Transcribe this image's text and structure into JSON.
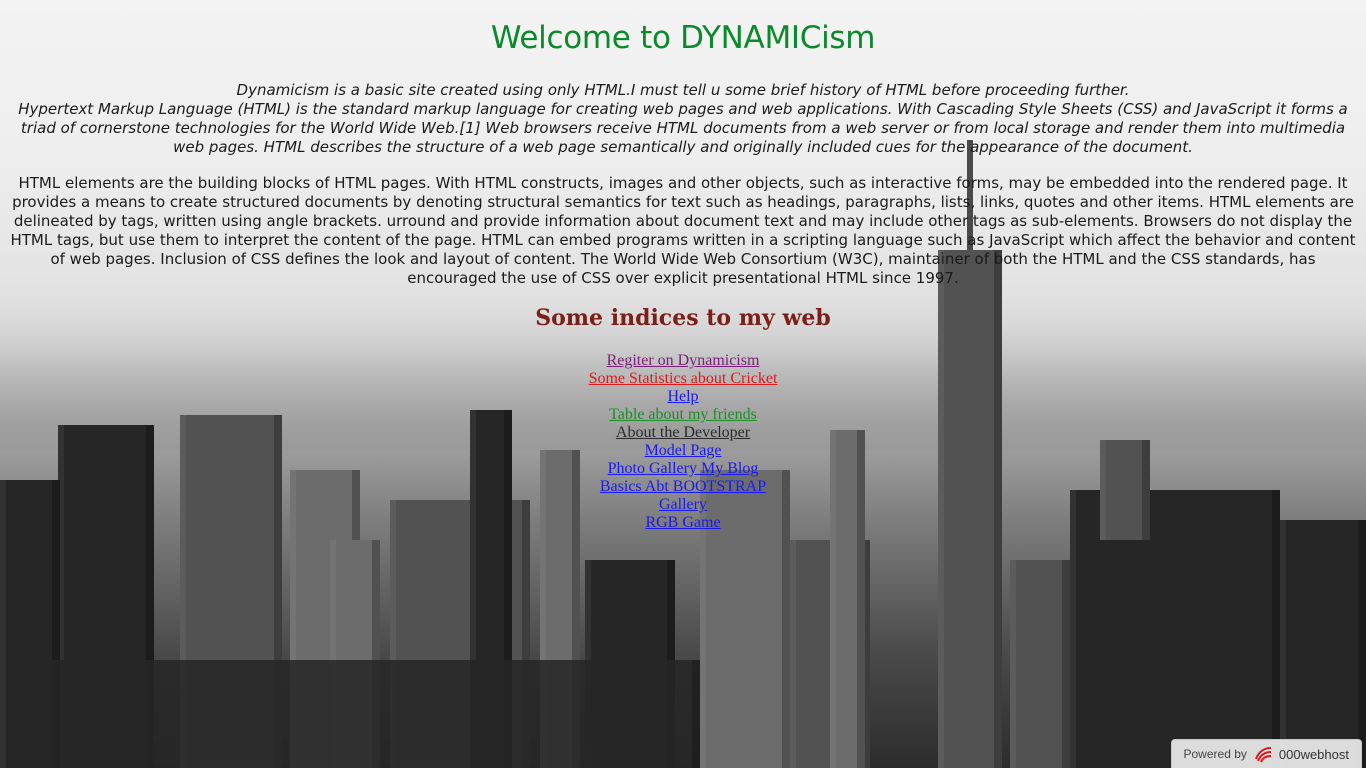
{
  "page": {
    "title": "Welcome to DYNAMICism"
  },
  "intro": {
    "line1": "Dynamicism is a basic site created using only HTML.I must tell u some brief history of HTML before proceeding further.",
    "line2": "Hypertext Markup Language (HTML) is the standard markup language for creating web pages and web applications. With Cascading Style Sheets (CSS) and JavaScript it forms a triad of cornerstone technologies for the World Wide Web.[1] Web browsers receive HTML documents from a web server or from local storage and render them into multimedia web pages. HTML describes the structure of a web page semantically and originally included cues for the appearance of the document."
  },
  "paragraph": "HTML elements are the building blocks of HTML pages. With HTML constructs, images and other objects, such as interactive forms, may be embedded into the rendered page. It provides a means to create structured documents by denoting structural semantics for text such as headings, paragraphs, lists, links, quotes and other items. HTML elements are delineated by tags, written using angle brackets. urround and provide information about document text and may include other tags as sub-elements. Browsers do not display the HTML tags, but use them to interpret the content of the page. HTML can embed programs written in a scripting language such as JavaScript which affect the behavior and content of web pages. Inclusion of CSS defines the look and layout of content. The World Wide Web Consortium (W3C), maintainer of both the HTML and the CSS standards, has encouraged the use of CSS over explicit presentational HTML since 1997.",
  "indices": {
    "heading": "Some indices to my web",
    "links": [
      {
        "label": "Regiter on Dynamicism",
        "color": "#7b1f7a"
      },
      {
        "label": "Some Statistics about Cricket",
        "color": "#e0191b"
      },
      {
        "label": "Help",
        "color": "#1a1aee"
      },
      {
        "label": "Table about my friends",
        "color": "#1f8c2a"
      },
      {
        "label": "About the Developer",
        "color": "#2a2a2a"
      },
      {
        "label": "Model Page",
        "color": "#1a1aee"
      },
      {
        "label": "Photo Gallery My  Blog",
        "color": "#1a1aee"
      },
      {
        "label": "Basics Abt BOOTSTRAP",
        "color": "#1a1aee"
      },
      {
        "label": "Gallery",
        "color": "#1a1aee"
      },
      {
        "label": "RGB Game",
        "color": "#1a1aee"
      }
    ]
  },
  "footer": {
    "powered_by": "Powered by",
    "brand": "000webhost",
    "logo_icon": "webhost-logo-icon",
    "logo_color": "#e0191b"
  },
  "colors": {
    "title": "#0b8a2c",
    "heading": "#7a2018"
  }
}
